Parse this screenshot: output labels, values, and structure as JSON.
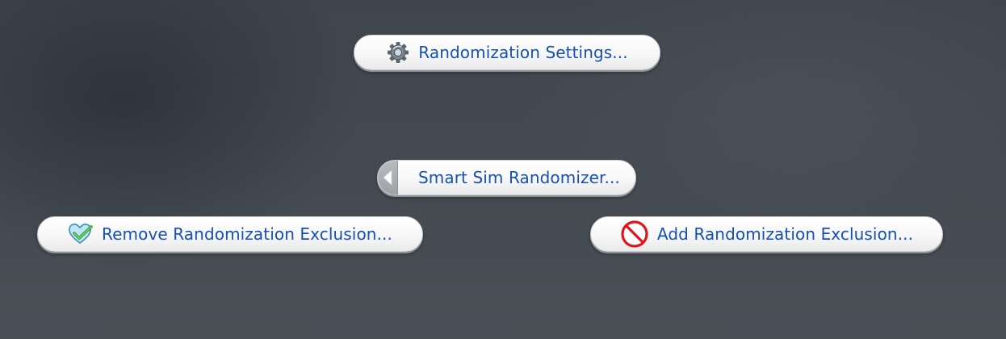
{
  "pie_menu": {
    "settings_label": "Randomization Settings...",
    "smart_label": "Smart Sim Randomizer...",
    "remove_label": "Remove Randomization Exclusion...",
    "add_label": "Add Randomization Exclusion..."
  },
  "icons": {
    "settings": "gear-icon",
    "back": "back-arrow-icon",
    "remove": "heart-check-icon",
    "add": "prohibited-icon"
  },
  "colors": {
    "label": "#1550b4",
    "background": "#444a51",
    "button": "#f7f7f7"
  }
}
